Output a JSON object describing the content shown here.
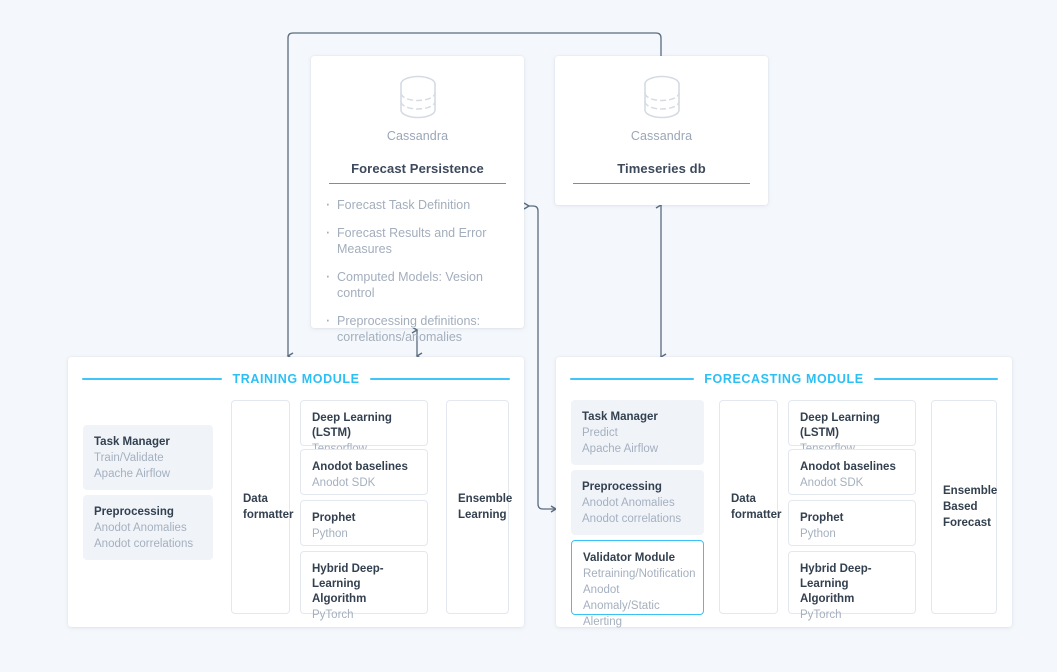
{
  "colors": {
    "background": "#f4f7fb",
    "accent_cyan": "#2bc0f5",
    "card_white": "#ffffff",
    "block_fill": "#f0f4f9",
    "heading_dark": "#33404f",
    "muted_text": "#a5b0bf",
    "connector": "#5b6b7e"
  },
  "persistence_card": {
    "icon": "database-cylinder-icon",
    "db_label": "Cassandra",
    "title": "Forecast Persistence",
    "bullets": [
      "Forecast Task Definition",
      "Forecast Results and Error Measures",
      "Computed Models: Vesion control",
      "Preprocessing definitions: correlations/anomalies"
    ]
  },
  "timeseries_card": {
    "icon": "database-cylinder-icon",
    "db_label": "Cassandra",
    "title": "Timeseries db"
  },
  "training_module": {
    "header": "TRAINING MODULE",
    "left_blocks": [
      {
        "title": "Task Manager",
        "lines": [
          "Train/Validate",
          "Apache Airflow"
        ]
      },
      {
        "title": "Preprocessing",
        "lines": [
          "Anodot Anomalies",
          "Anodot correlations"
        ]
      }
    ],
    "formatter": {
      "title": "Data formatter"
    },
    "algorithms": [
      {
        "title": "Deep Learning (LSTM)",
        "subtitle": "Tensorflow"
      },
      {
        "title": "Anodot baselines",
        "subtitle": "Anodot SDK"
      },
      {
        "title": "Prophet",
        "subtitle": "Python"
      },
      {
        "title": "Hybrid Deep-Learning Algorithm",
        "subtitle": "PyTorch"
      }
    ],
    "output": {
      "title": "Ensemble Learning"
    }
  },
  "forecasting_module": {
    "header": "FORECASTING MODULE",
    "left_blocks": [
      {
        "title": "Task Manager",
        "lines": [
          "Predict",
          "Apache Airflow"
        ],
        "accent": false
      },
      {
        "title": "Preprocessing",
        "lines": [
          "Anodot Anomalies",
          "Anodot correlations"
        ],
        "accent": false
      },
      {
        "title": "Validator Module",
        "lines": [
          "Retraining/Notification",
          "Anodot Anomaly/Static",
          "Alerting"
        ],
        "accent": true
      }
    ],
    "formatter": {
      "title": "Data formatter"
    },
    "algorithms": [
      {
        "title": "Deep Learning (LSTM)",
        "subtitle": "Tensorflow"
      },
      {
        "title": "Anodot baselines",
        "subtitle": "Anodot SDK"
      },
      {
        "title": "Prophet",
        "subtitle": "Python"
      },
      {
        "title": "Hybrid Deep-Learning Algorithm",
        "subtitle": "PyTorch"
      }
    ],
    "output": {
      "title": "Ensemble Based Forecast"
    }
  }
}
